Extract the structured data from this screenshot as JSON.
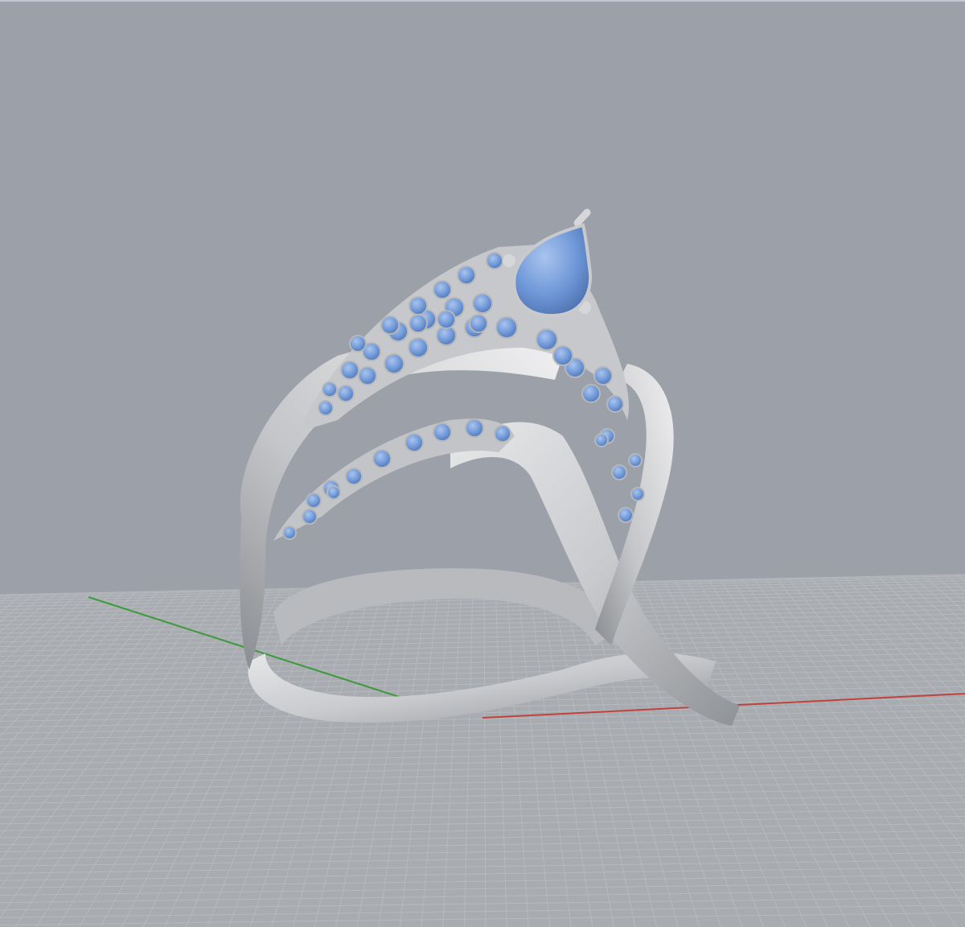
{
  "viewport": {
    "background": "#9ca1a9",
    "floor": "#a8abb0",
    "grid_line": "#b6b9bd",
    "axis_colors": {
      "x": "#c0423c",
      "y": "#3c9a3c"
    },
    "metal_color": "#cfd0d2",
    "gem_color": "#6f98d8"
  }
}
